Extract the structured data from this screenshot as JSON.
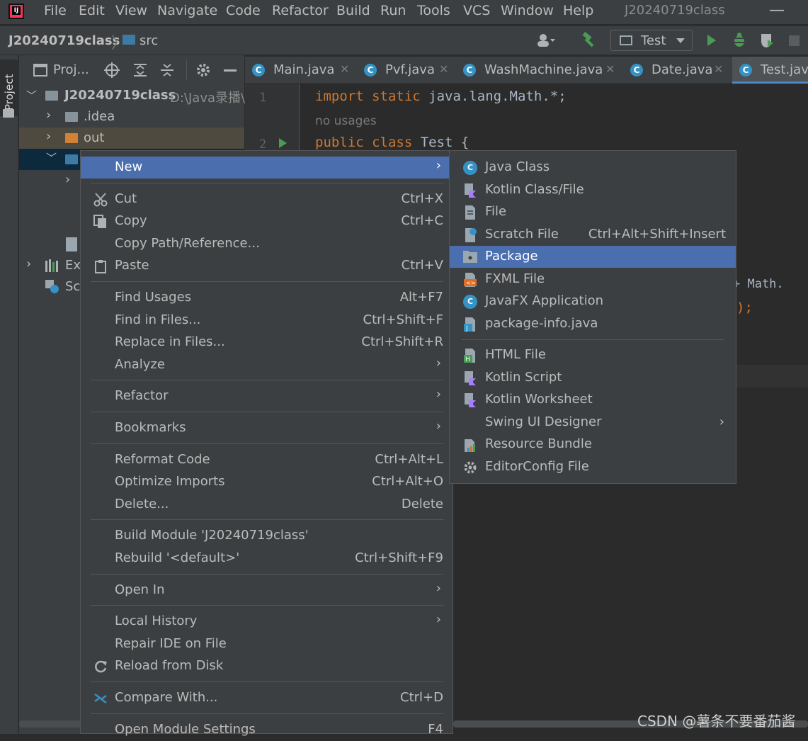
{
  "menubar": {
    "logo": "IJ",
    "items": [
      {
        "label": "File"
      },
      {
        "label": "Edit"
      },
      {
        "label": "View"
      },
      {
        "label": "Navigate"
      },
      {
        "label": "Code"
      },
      {
        "label": "Refactor"
      },
      {
        "label": "Build"
      },
      {
        "label": "Run"
      },
      {
        "label": "Tools"
      },
      {
        "label": "VCS"
      },
      {
        "label": "Window"
      },
      {
        "label": "Help"
      }
    ],
    "window_title": "J20240719class",
    "minimize_glyph": "—"
  },
  "navbar": {
    "project": "J20240719class",
    "separator": "〉",
    "folder": "src",
    "run_config": "Test"
  },
  "tool_window": {
    "tab_label": "Project"
  },
  "project_panel": {
    "title": "Proj...",
    "tree": [
      {
        "label": "J20240719class",
        "path": "D:\\Java录播\\"
      },
      {
        "label": ".idea"
      },
      {
        "label": "out"
      },
      {
        "label": "Ex"
      },
      {
        "label": "Sc"
      }
    ]
  },
  "tabs": [
    {
      "label": "Main.java"
    },
    {
      "label": "Pvf.java"
    },
    {
      "label": "WashMachine.java"
    },
    {
      "label": "Date.java"
    },
    {
      "label": "Test.java"
    }
  ],
  "editor": {
    "line1_no": "1",
    "line1_kw": "import static",
    "line1_rest": "java.lang.Math.*;",
    "hint": "no usages",
    "line2_no": "2",
    "line2_kw": "public class",
    "line2_rest": "Test {",
    "frag1": "+ Math.",
    "frag2": ");"
  },
  "context_menu": [
    {
      "label": "New",
      "shortcut": "",
      "submenu": true,
      "highlight": true
    },
    {
      "sep": true
    },
    {
      "label": "Cut",
      "shortcut": "Ctrl+X",
      "icon": "scissors-icon"
    },
    {
      "label": "Copy",
      "shortcut": "Ctrl+C",
      "icon": "copy-icon"
    },
    {
      "label": "Copy Path/Reference...",
      "shortcut": ""
    },
    {
      "label": "Paste",
      "shortcut": "Ctrl+V",
      "icon": "paste-icon"
    },
    {
      "sep": true
    },
    {
      "label": "Find Usages",
      "shortcut": "Alt+F7"
    },
    {
      "label": "Find in Files...",
      "shortcut": "Ctrl+Shift+F"
    },
    {
      "label": "Replace in Files...",
      "shortcut": "Ctrl+Shift+R"
    },
    {
      "label": "Analyze",
      "shortcut": "",
      "submenu": true
    },
    {
      "sep": true
    },
    {
      "label": "Refactor",
      "shortcut": "",
      "submenu": true
    },
    {
      "sep": true
    },
    {
      "label": "Bookmarks",
      "shortcut": "",
      "submenu": true
    },
    {
      "sep": true
    },
    {
      "label": "Reformat Code",
      "shortcut": "Ctrl+Alt+L"
    },
    {
      "label": "Optimize Imports",
      "shortcut": "Ctrl+Alt+O"
    },
    {
      "label": "Delete...",
      "shortcut": "Delete"
    },
    {
      "sep": true
    },
    {
      "label": "Build Module 'J20240719class'",
      "shortcut": ""
    },
    {
      "label": "Rebuild '<default>'",
      "shortcut": "Ctrl+Shift+F9"
    },
    {
      "sep": true
    },
    {
      "label": "Open In",
      "shortcut": "",
      "submenu": true
    },
    {
      "sep": true
    },
    {
      "label": "Local History",
      "shortcut": "",
      "submenu": true
    },
    {
      "label": "Repair IDE on File",
      "shortcut": ""
    },
    {
      "label": "Reload from Disk",
      "shortcut": "",
      "icon": "reload-icon"
    },
    {
      "sep": true
    },
    {
      "label": "Compare With...",
      "shortcut": "Ctrl+D",
      "icon": "compare-icon"
    },
    {
      "sep": true
    },
    {
      "label": "Open Module Settings",
      "shortcut": "F4"
    }
  ],
  "submenu": [
    {
      "label": "Java Class",
      "icon": "java-class-icon",
      "shortcut": ""
    },
    {
      "label": "Kotlin Class/File",
      "icon": "kotlin-file-icon",
      "shortcut": ""
    },
    {
      "label": "File",
      "icon": "file-icon",
      "shortcut": ""
    },
    {
      "label": "Scratch File",
      "icon": "scratch-file-icon",
      "shortcut": "Ctrl+Alt+Shift+Insert"
    },
    {
      "label": "Package",
      "icon": "package-icon",
      "shortcut": "",
      "highlight": true
    },
    {
      "label": "FXML File",
      "icon": "fxml-file-icon",
      "shortcut": ""
    },
    {
      "label": "JavaFX Application",
      "icon": "javafx-app-icon",
      "shortcut": ""
    },
    {
      "label": "package-info.java",
      "icon": "package-info-icon",
      "shortcut": ""
    },
    {
      "sep": true
    },
    {
      "label": "HTML File",
      "icon": "html-file-icon",
      "shortcut": ""
    },
    {
      "label": "Kotlin Script",
      "icon": "kotlin-script-icon",
      "shortcut": ""
    },
    {
      "label": "Kotlin Worksheet",
      "icon": "kotlin-worksheet-icon",
      "shortcut": ""
    },
    {
      "label": "Swing UI Designer",
      "icon": "",
      "shortcut": "",
      "submenu": true
    },
    {
      "label": "Resource Bundle",
      "icon": "resource-bundle-icon",
      "shortcut": ""
    },
    {
      "label": "EditorConfig File",
      "icon": "gear-icon",
      "shortcut": ""
    }
  ],
  "watermark": "CSDN @薯条不要番茄酱",
  "colors": {
    "highlight": "#4b6eaf",
    "keyword": "#cc7832",
    "menu_bg": "#3c3f41",
    "editor_bg": "#2b2b2b"
  }
}
